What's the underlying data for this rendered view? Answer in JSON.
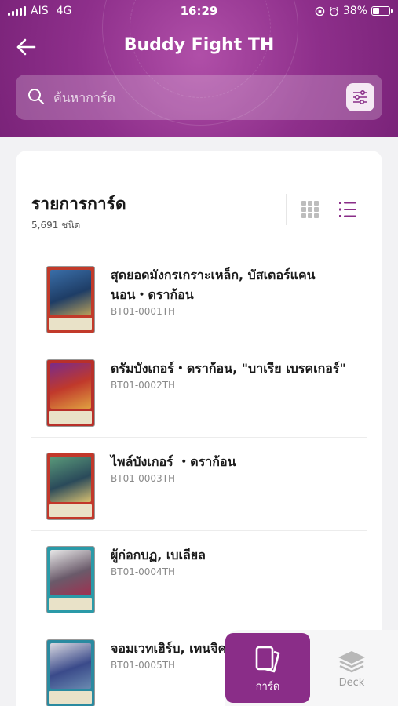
{
  "status_bar": {
    "carrier": "AIS",
    "network": "4G",
    "time": "16:29",
    "battery": "38%",
    "battery_level": 0.38
  },
  "header": {
    "title": "Buddy Fight TH",
    "back_icon": "arrow-left-icon"
  },
  "search": {
    "placeholder": "ค้นหาการ์ด",
    "value": ""
  },
  "card_list": {
    "title": "รายการการ์ด",
    "count": "5,691 ชนิด",
    "view_modes": [
      "grid-icon",
      "list-icon"
    ],
    "active_view": "list"
  },
  "cards": [
    {
      "name": "สุดยอดมังกรเกราะเหล็ก, บัสเตอร์แคนนอน・ดราก้อน",
      "code": "BT01-0001TH"
    },
    {
      "name": "ดรัมบังเกอร์・ดราก้อน, \"บาเรีย เบรคเกอร์\"",
      "code": "BT01-0002TH"
    },
    {
      "name": "ไพล์บังเกอร์ ・ดราก้อน",
      "code": "BT01-0003TH"
    },
    {
      "name": "ผู้ก่อกบฏ, เบเลียล",
      "code": "BT01-0004TH"
    },
    {
      "name": "จอมเวทเฮิร์บ, เทนจิค",
      "code": "BT01-0005TH"
    }
  ],
  "bottom_nav": {
    "cards_label": "การ์ด",
    "deck_label": "Deck"
  },
  "colors": {
    "brand": "#8a2d88",
    "accent": "#8e2f8b"
  }
}
